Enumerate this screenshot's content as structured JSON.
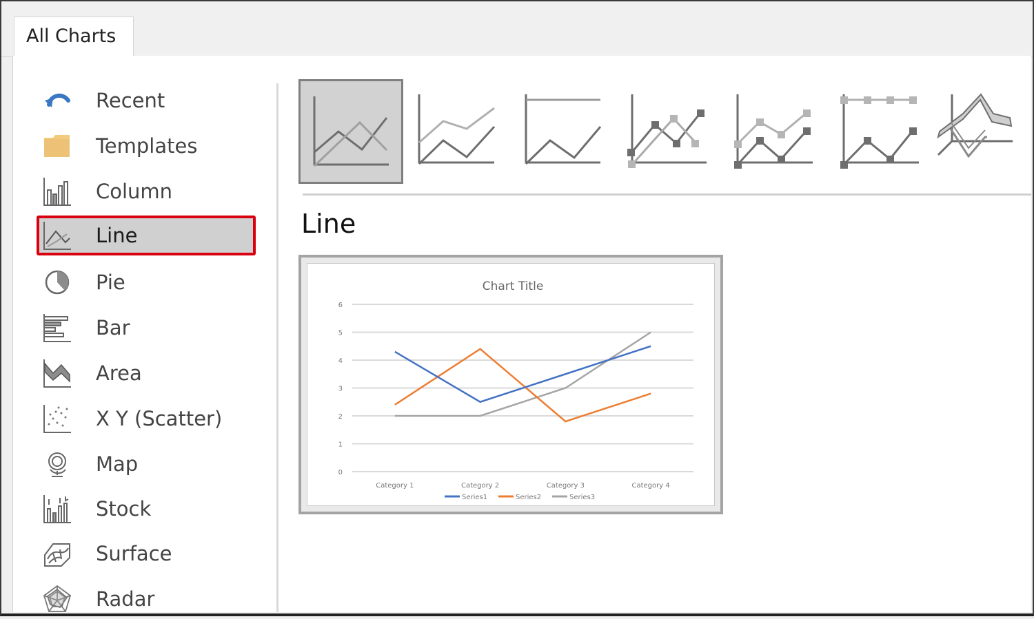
{
  "dialog": {
    "tab_label": "All Charts",
    "selected_type_title": "Line"
  },
  "sidebar": {
    "items": [
      {
        "label": "Recent",
        "icon": "recent-icon"
      },
      {
        "label": "Templates",
        "icon": "folder-icon"
      },
      {
        "label": "Column",
        "icon": "column-chart-icon"
      },
      {
        "label": "Line",
        "icon": "line-chart-icon",
        "selected": true
      },
      {
        "label": "Pie",
        "icon": "pie-chart-icon"
      },
      {
        "label": "Bar",
        "icon": "bar-chart-icon"
      },
      {
        "label": "Area",
        "icon": "area-chart-icon"
      },
      {
        "label": "X Y (Scatter)",
        "icon": "scatter-chart-icon"
      },
      {
        "label": "Map",
        "icon": "map-globe-icon"
      },
      {
        "label": "Stock",
        "icon": "stock-chart-icon"
      },
      {
        "label": "Surface",
        "icon": "surface-chart-icon"
      },
      {
        "label": "Radar",
        "icon": "radar-chart-icon"
      }
    ],
    "highlight_color": "#d9000f"
  },
  "subtypes": [
    {
      "name": "line",
      "selected": true
    },
    {
      "name": "stacked-line"
    },
    {
      "name": "100-percent-stacked-line"
    },
    {
      "name": "line-with-markers"
    },
    {
      "name": "stacked-line-with-markers"
    },
    {
      "name": "100-percent-stacked-line-with-markers"
    },
    {
      "name": "3d-line"
    }
  ],
  "chart_data": {
    "type": "line",
    "title": "Chart Title",
    "categories": [
      "Category 1",
      "Category 2",
      "Category 3",
      "Category 4"
    ],
    "series": [
      {
        "name": "Series1",
        "values": [
          4.3,
          2.5,
          3.5,
          4.5
        ],
        "color": "#4472c4"
      },
      {
        "name": "Series2",
        "values": [
          2.4,
          4.4,
          1.8,
          2.8
        ],
        "color": "#ed7d31"
      },
      {
        "name": "Series3",
        "values": [
          2,
          2,
          3,
          5
        ],
        "color": "#a5a5a5"
      }
    ],
    "yticks": [
      "0",
      "1",
      "2",
      "3",
      "4",
      "5",
      "6"
    ],
    "ylim": [
      0,
      6
    ],
    "xlabel": "",
    "ylabel": "",
    "grid": true,
    "legend": "bottom"
  }
}
